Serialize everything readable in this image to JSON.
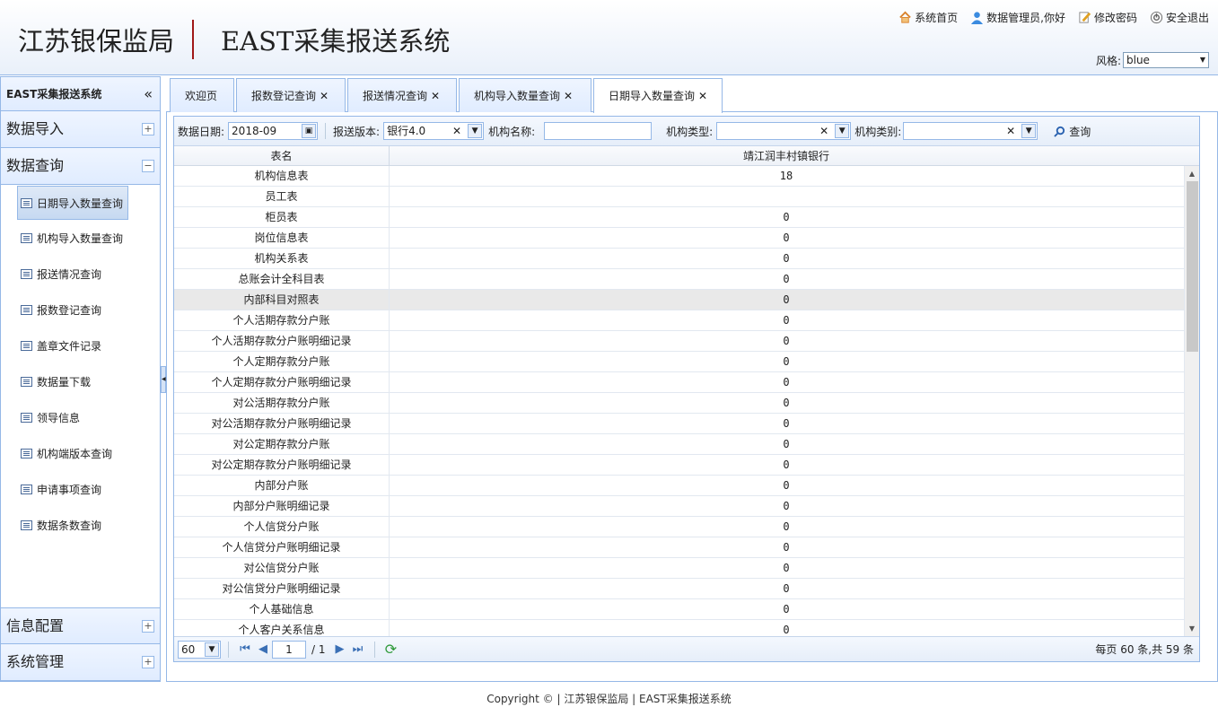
{
  "header": {
    "org": "江苏银保监局",
    "system": "EAST采集报送系统",
    "links": {
      "home": "系统首页",
      "user": "数据管理员,你好",
      "password": "修改密码",
      "logout": "安全退出"
    },
    "theme_label": "风格:",
    "theme_value": "blue"
  },
  "sidebar": {
    "title": "EAST采集报送系统",
    "collapse": "«",
    "sections": {
      "import": "数据导入",
      "query": "数据查询",
      "config": "信息配置",
      "admin": "系统管理"
    },
    "query_items": [
      "日期导入数量查询",
      "机构导入数量查询",
      "报送情况查询",
      "报数登记查询",
      "盖章文件记录",
      "数据量下载",
      "领导信息",
      "机构端版本查询",
      "申请事项查询",
      "数据条数查询"
    ]
  },
  "tabs": [
    "欢迎页",
    "报数登记查询",
    "报送情况查询",
    "机构导入数量查询",
    "日期导入数量查询"
  ],
  "toolbar": {
    "date_label": "数据日期:",
    "date_value": "2018-09",
    "version_label": "报送版本:",
    "version_value": "银行4.0",
    "orgname_label": "机构名称:",
    "orgname_value": "",
    "orgtype_label": "机构类型:",
    "orgtype_value": "",
    "orgcat_label": "机构类别:",
    "orgcat_value": "",
    "search_label": "查询"
  },
  "grid": {
    "col_name": "表名",
    "col_bank": "靖江润丰村镇银行",
    "rows": [
      [
        "机构信息表",
        "18"
      ],
      [
        "员工表",
        ""
      ],
      [
        "柜员表",
        "0"
      ],
      [
        "岗位信息表",
        "0"
      ],
      [
        "机构关系表",
        "0"
      ],
      [
        "总账会计全科目表",
        "0"
      ],
      [
        "内部科目对照表",
        "0"
      ],
      [
        "个人活期存款分户账",
        "0"
      ],
      [
        "个人活期存款分户账明细记录",
        "0"
      ],
      [
        "个人定期存款分户账",
        "0"
      ],
      [
        "个人定期存款分户账明细记录",
        "0"
      ],
      [
        "对公活期存款分户账",
        "0"
      ],
      [
        "对公活期存款分户账明细记录",
        "0"
      ],
      [
        "对公定期存款分户账",
        "0"
      ],
      [
        "对公定期存款分户账明细记录",
        "0"
      ],
      [
        "内部分户账",
        "0"
      ],
      [
        "内部分户账明细记录",
        "0"
      ],
      [
        "个人信贷分户账",
        "0"
      ],
      [
        "个人信贷分户账明细记录",
        "0"
      ],
      [
        "对公信贷分户账",
        "0"
      ],
      [
        "对公信贷分户账明细记录",
        "0"
      ],
      [
        "个人基础信息",
        "0"
      ],
      [
        "个人客户关系信息",
        "0"
      ]
    ]
  },
  "pager": {
    "page_size": "60",
    "page": "1",
    "total_pages": "/ 1",
    "info": "每页 60 条,共 59 条"
  },
  "footer": "Copyright © | 江苏银保监局 | EAST采集报送系统"
}
